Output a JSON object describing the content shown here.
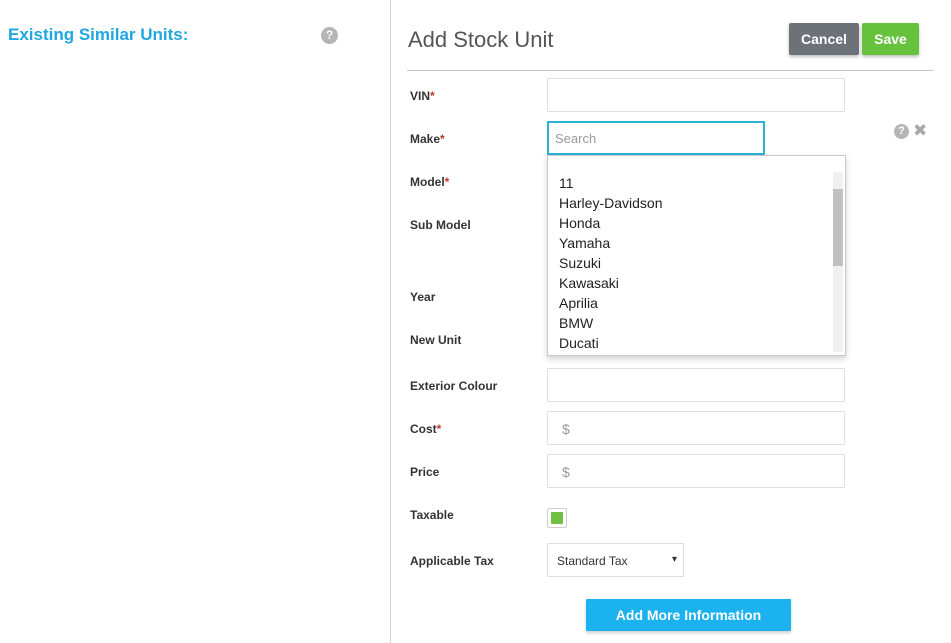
{
  "left_panel": {
    "title": "Existing Similar Units:",
    "help_icon": "question-circle-icon"
  },
  "header": {
    "title": "Add Stock Unit",
    "cancel_label": "Cancel",
    "save_label": "Save"
  },
  "form": {
    "vin_label": "VIN",
    "make_label": "Make",
    "model_label": "Model",
    "sub_model_label": "Sub Model",
    "year_label": "Year",
    "new_unit_label": "New Unit",
    "exterior_colour_label": "Exterior Colour",
    "cost_label": "Cost",
    "price_label": "Price",
    "taxable_label": "Taxable",
    "applicable_tax_label": "Applicable Tax",
    "required_mark": "*",
    "currency_symbol": "$",
    "taxable_checked": true,
    "applicable_tax_value": "Standard Tax",
    "select_arrow": "▾"
  },
  "make_search": {
    "placeholder": "Search",
    "options": [
      "11",
      "Harley-Davidson",
      "Honda",
      "Yamaha",
      "Suzuki",
      "Kawasaki",
      "Aprilia",
      "BMW",
      "Ducati"
    ]
  },
  "icons": {
    "help": "?",
    "close": "✖"
  },
  "footer": {
    "add_more_label": "Add More Information"
  },
  "colors": {
    "accent_blue": "#1ea7e1",
    "save_green": "#66c13d",
    "cancel_gray": "#6d7278",
    "search_border": "#2bb3d8"
  }
}
